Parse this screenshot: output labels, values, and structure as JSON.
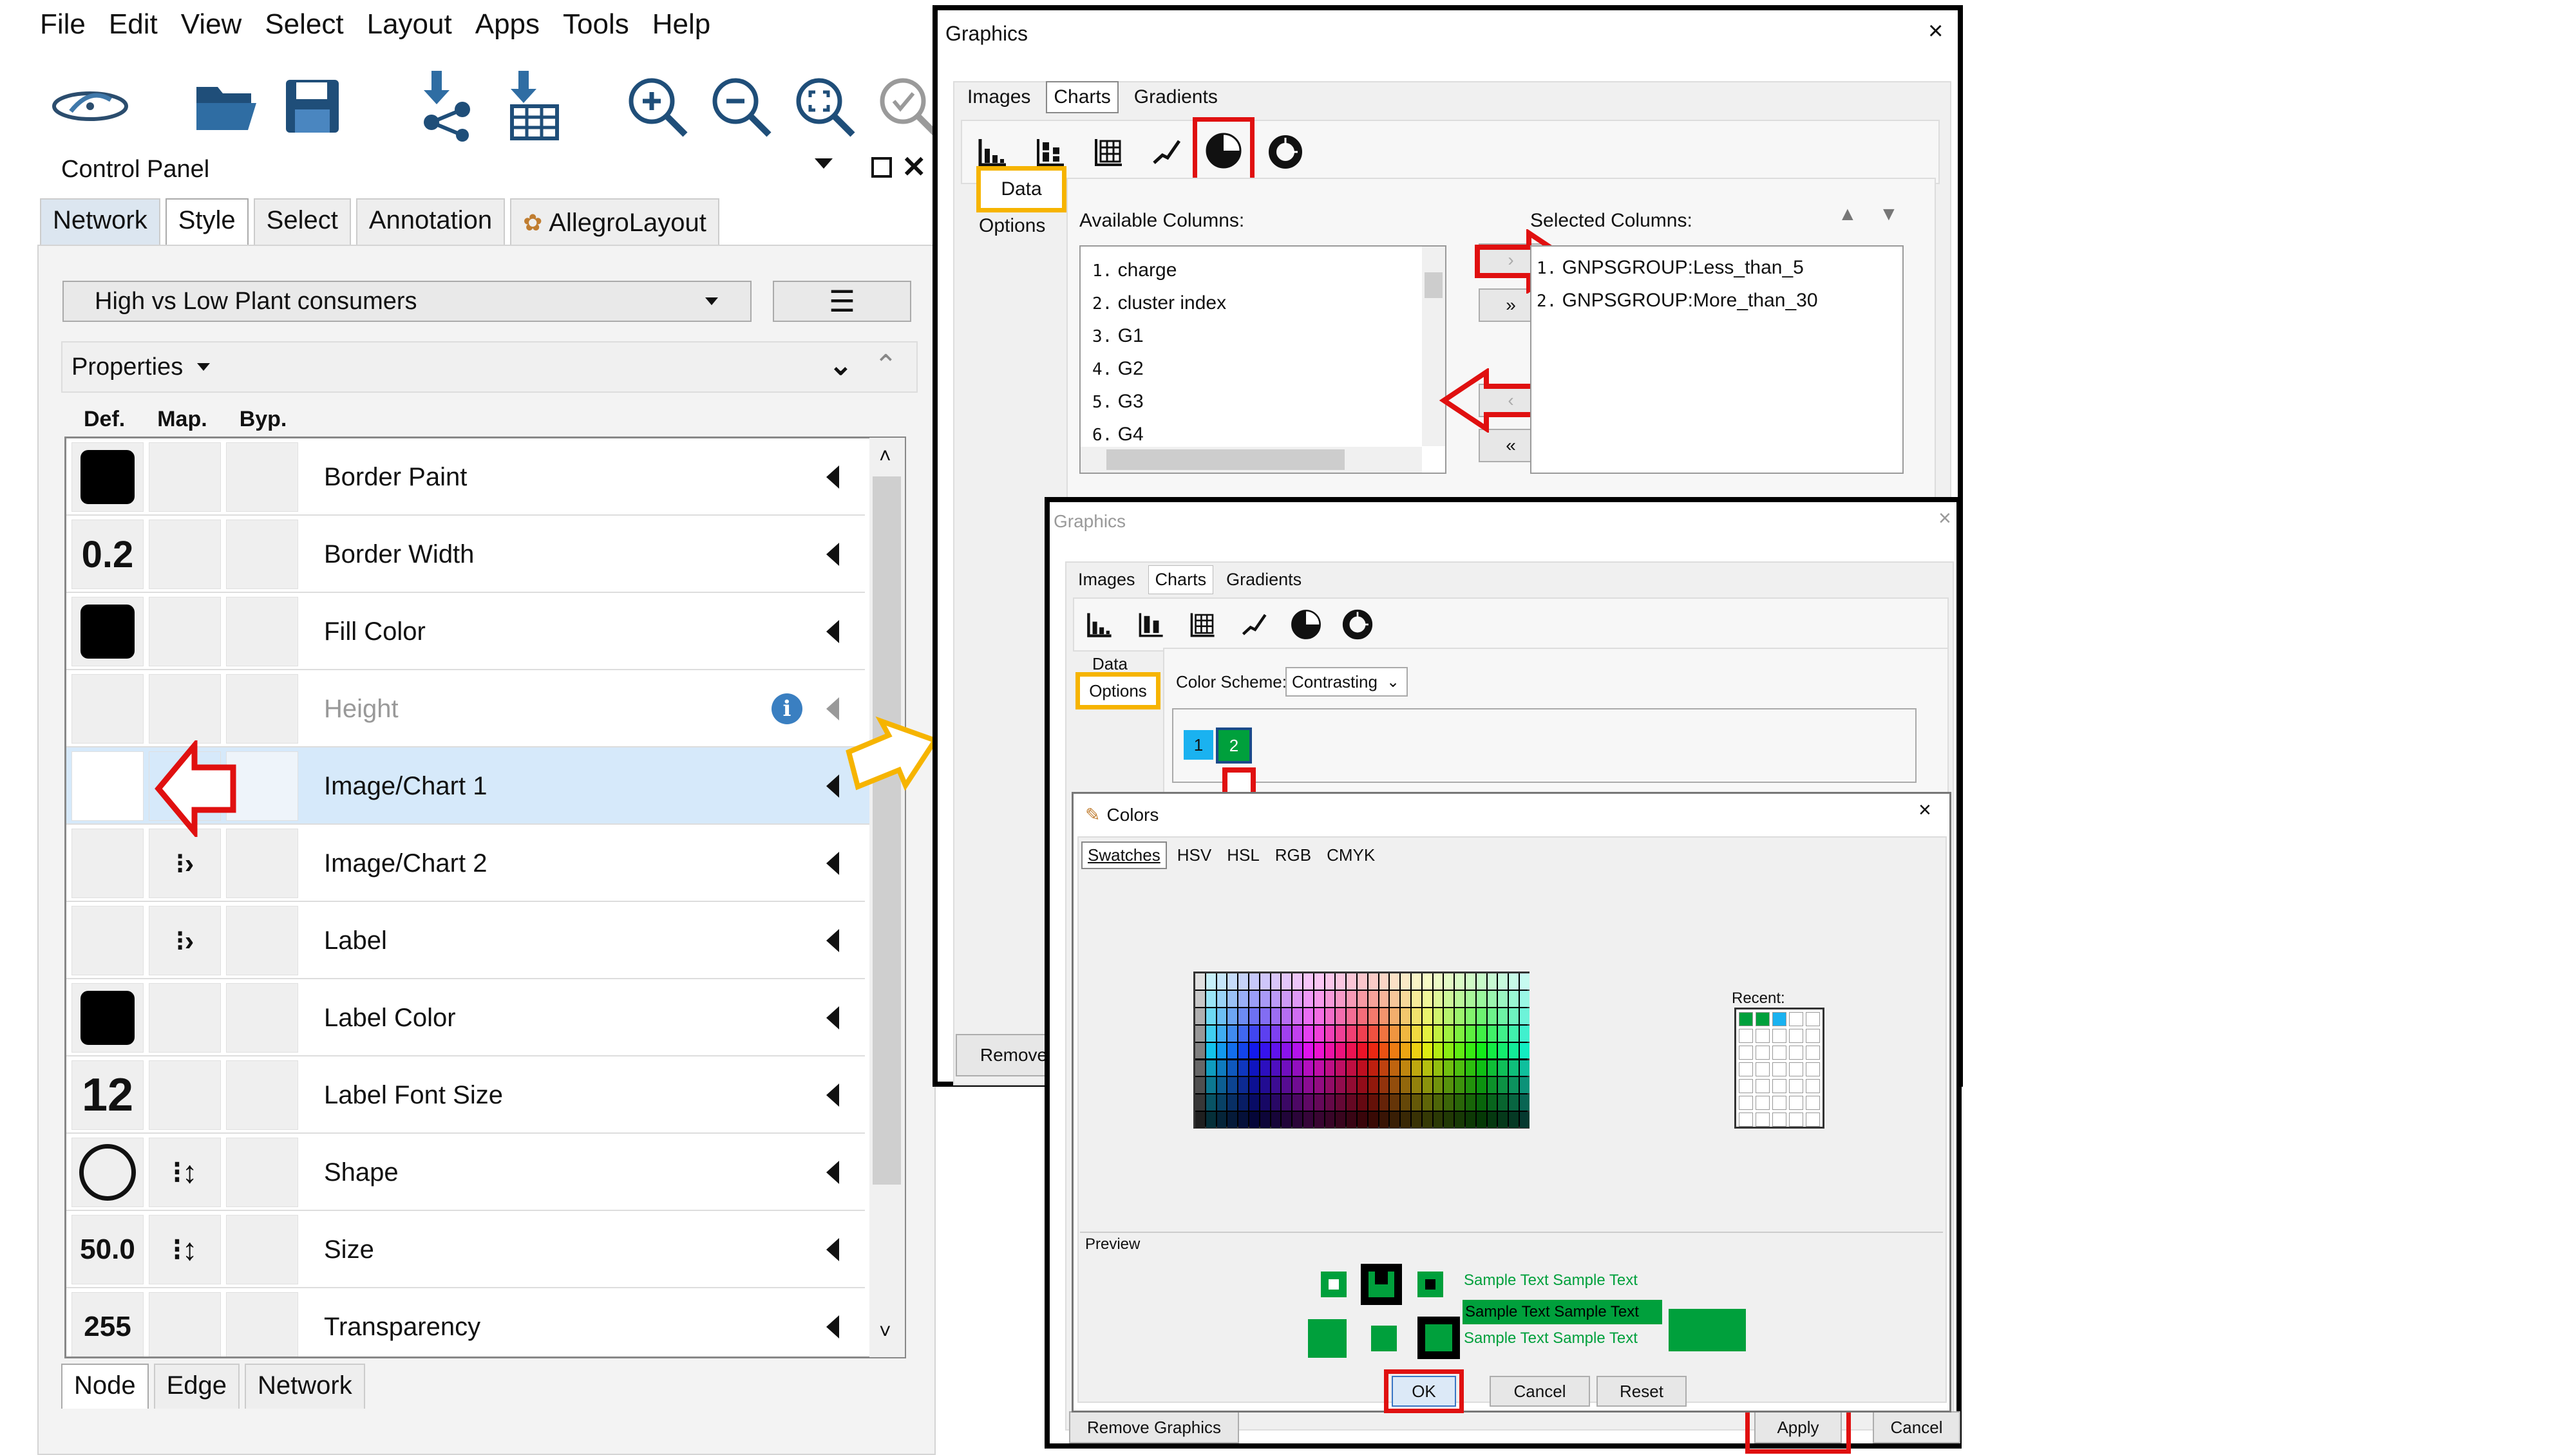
{
  "menu": [
    "File",
    "Edit",
    "View",
    "Select",
    "Layout",
    "Apps",
    "Tools",
    "Help"
  ],
  "toolbar_icons": [
    "network-logo-icon",
    "open-folder-icon",
    "save-icon",
    "import-network-icon",
    "import-table-icon",
    "zoom-in-icon",
    "zoom-out-icon",
    "zoom-fit-icon",
    "zoom-selected-icon"
  ],
  "control_panel": {
    "title": "Control Panel",
    "tabs": [
      "Network",
      "Style",
      "Select",
      "Annotation",
      "AllegroLayout"
    ],
    "selected_tab": "Style",
    "style_name": "High vs Low Plant consumers",
    "properties_label": "Properties",
    "columns": [
      "Def.",
      "Map.",
      "Byp."
    ],
    "rows": [
      {
        "name": "Border Paint"
      },
      {
        "name": "Border Width",
        "def": "0.2"
      },
      {
        "name": "Fill Color"
      },
      {
        "name": "Height"
      },
      {
        "name": "Image/Chart 1"
      },
      {
        "name": "Image/Chart 2"
      },
      {
        "name": "Label"
      },
      {
        "name": "Label Color"
      },
      {
        "name": "Label Font Size",
        "def": "12"
      },
      {
        "name": "Shape"
      },
      {
        "name": "Size",
        "def": "50.0"
      },
      {
        "name": "Transparency",
        "def": "255"
      }
    ],
    "bottom_tabs": [
      "Node",
      "Edge",
      "Network"
    ]
  },
  "graphics1": {
    "title": "Graphics",
    "tabs": [
      "Images",
      "Charts",
      "Gradients"
    ],
    "side_tabs": [
      "Data",
      "Options"
    ],
    "available_label": "Available Columns:",
    "available": [
      "charge",
      "cluster index",
      "G1",
      "G2",
      "G3",
      "G4"
    ],
    "selected_label": "Selected Columns:",
    "selected": [
      "GNPSGROUP:Less_than_5",
      "GNPSGROUP:More_than_30"
    ],
    "remove_label": "Remove",
    "close": "×"
  },
  "graphics2": {
    "title": "Graphics",
    "tabs": [
      "Images",
      "Charts",
      "Gradients"
    ],
    "side_tabs": [
      "Data",
      "Options"
    ],
    "color_scheme_label": "Color Scheme:",
    "color_scheme": "Contrasting",
    "swatch_labels": [
      "1",
      "2"
    ],
    "remove_graphics": "Remove Graphics",
    "apply": "Apply",
    "cancel": "Cancel",
    "close": "×"
  },
  "colors": {
    "title": "Colors",
    "tabs": [
      "Swatches",
      "HSV",
      "HSL",
      "RGB",
      "CMYK"
    ],
    "recent_label": "Recent:",
    "preview_label": "Preview",
    "sample_text": "Sample Text",
    "ok": "OK",
    "cancel": "Cancel",
    "reset": "Reset",
    "close": "×",
    "accent": "#00a03c"
  },
  "accent_colors": {
    "highlight_red": "#e01010",
    "highlight_yellow": "#f6b400",
    "selection_blue": "#d6e9fa"
  }
}
